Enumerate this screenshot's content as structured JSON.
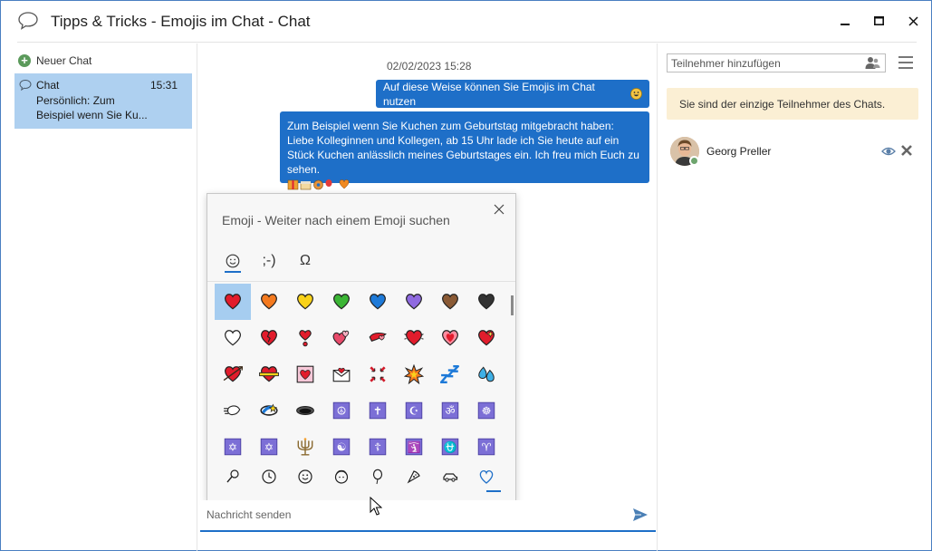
{
  "window": {
    "title": "Tipps & Tricks - Emojis im Chat - Chat"
  },
  "sidebar": {
    "new_chat_label": "Neuer Chat",
    "items": [
      {
        "name": "Chat",
        "time": "15:31",
        "line2": "Persönlich: Zum",
        "line3": "Beispiel wenn Sie Ku..."
      }
    ]
  },
  "conversation": {
    "date_stamp": "02/02/2023 15:28",
    "messages": [
      {
        "text": "Auf diese Weise können Sie Emojis im Chat nutzen"
      },
      {
        "text": "Zum Beispiel wenn Sie Kuchen zum Geburtstag mitgebracht haben: Liebe Kolleginnen und Kollegen, ab 15 Uhr lade ich Sie heute auf ein Stück Kuchen anlässlich meines Geburtstages ein. Ich freu mich Euch zu sehen."
      }
    ]
  },
  "emoji_picker": {
    "search_placeholder": "Emoji - Weiter nach einem Emoji suchen",
    "tabs": [
      "☺",
      ";-)",
      "Ω"
    ],
    "selected_tab": 0,
    "selected_category": "heart-category",
    "rows": [
      [
        "red-heart",
        "orange-heart",
        "yellow-heart",
        "green-heart",
        "blue-heart",
        "purple-heart",
        "brown-heart",
        "black-heart"
      ],
      [
        "white-heart",
        "broken-heart",
        "heart-exclamation",
        "two-hearts",
        "revolving-hearts",
        "beating-heart",
        "growing-heart",
        "sparkling-heart"
      ],
      [
        "heart-with-arrow",
        "heart-with-ribbon",
        "heart-decoration",
        "love-letter",
        "anger-symbol",
        "collision",
        "zzz",
        "sweat-droplets"
      ],
      [
        "dashing-away",
        "dizzy",
        "hole",
        "peace-symbol",
        "latin-cross",
        "star-and-crescent",
        "om",
        "wheel-of-dharma"
      ],
      [
        "star-of-david",
        "dotted-six-pointed-star",
        "menorah",
        "yin-yang",
        "orthodox-cross",
        "place-of-worship",
        "ophiuchus",
        "aries"
      ]
    ],
    "categories": [
      "search",
      "recent",
      "smileys",
      "people",
      "balloon",
      "food",
      "vehicle",
      "heart"
    ]
  },
  "composer": {
    "placeholder": "Nachricht senden"
  },
  "participants_panel": {
    "search_placeholder": "Teilnehmer hinzufügen",
    "info": "Sie sind der einzige Teilnehmer des Chats.",
    "participants": [
      {
        "name": "Georg Preller"
      }
    ]
  },
  "colors": {
    "accent": "#1e6fc8",
    "selected_item": "#aed0f0",
    "info_bg": "#fbefd4"
  }
}
